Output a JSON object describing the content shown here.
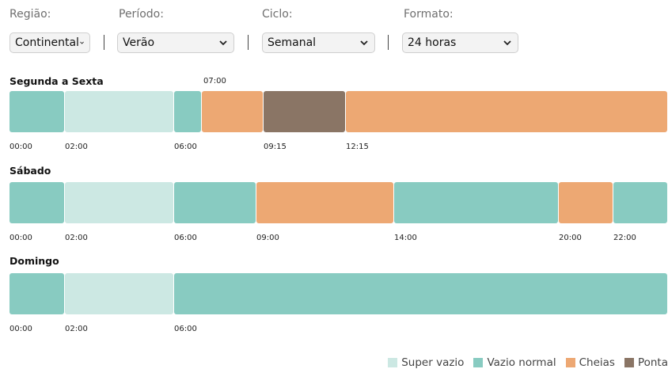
{
  "filters": {
    "regiao": {
      "label": "Região:",
      "value": "Continental"
    },
    "periodo": {
      "label": "Período:",
      "value": "Verão"
    },
    "ciclo": {
      "label": "Ciclo:",
      "value": "Semanal"
    },
    "formato": {
      "label": "Formato:",
      "value": "24 horas"
    }
  },
  "colors": {
    "super_vazio": "#cce8e3",
    "vazio_normal": "#88cbc1",
    "cheias": "#eda873",
    "ponta": "#8a7565"
  },
  "days": [
    {
      "title": "Segunda a Sexta",
      "annotation": "07:00",
      "segments": [
        {
          "start": "00:00",
          "end": "02:00",
          "type": "vazio_normal"
        },
        {
          "start": "02:00",
          "end": "06:00",
          "type": "super_vazio"
        },
        {
          "start": "06:00",
          "end": "07:00",
          "type": "vazio_normal"
        },
        {
          "start": "07:00",
          "end": "09:15",
          "type": "cheias"
        },
        {
          "start": "09:15",
          "end": "12:15",
          "type": "ponta"
        },
        {
          "start": "12:15",
          "end": "24:00",
          "type": "cheias"
        }
      ],
      "ticks": [
        "00:00",
        "02:00",
        "06:00",
        "09:15",
        "12:15"
      ]
    },
    {
      "title": "Sábado",
      "segments": [
        {
          "start": "00:00",
          "end": "02:00",
          "type": "vazio_normal"
        },
        {
          "start": "02:00",
          "end": "06:00",
          "type": "super_vazio"
        },
        {
          "start": "06:00",
          "end": "09:00",
          "type": "vazio_normal"
        },
        {
          "start": "09:00",
          "end": "14:00",
          "type": "cheias"
        },
        {
          "start": "14:00",
          "end": "20:00",
          "type": "vazio_normal"
        },
        {
          "start": "20:00",
          "end": "22:00",
          "type": "cheias"
        },
        {
          "start": "22:00",
          "end": "24:00",
          "type": "vazio_normal"
        }
      ],
      "ticks": [
        "00:00",
        "02:00",
        "06:00",
        "09:00",
        "14:00",
        "20:00",
        "22:00"
      ]
    },
    {
      "title": "Domingo",
      "segments": [
        {
          "start": "00:00",
          "end": "02:00",
          "type": "vazio_normal"
        },
        {
          "start": "02:00",
          "end": "06:00",
          "type": "super_vazio"
        },
        {
          "start": "06:00",
          "end": "24:00",
          "type": "vazio_normal"
        }
      ],
      "ticks": [
        "00:00",
        "02:00",
        "06:00"
      ]
    }
  ],
  "legend": [
    {
      "label": "Super vazio",
      "type": "super_vazio"
    },
    {
      "label": "Vazio normal",
      "type": "vazio_normal"
    },
    {
      "label": "Cheias",
      "type": "cheias"
    },
    {
      "label": "Ponta",
      "type": "ponta"
    }
  ]
}
